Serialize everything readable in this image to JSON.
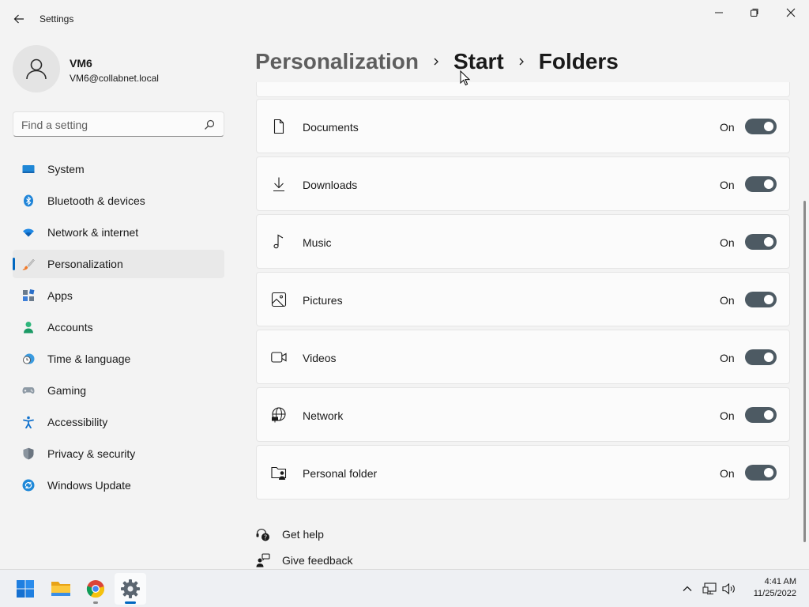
{
  "window": {
    "title": "Settings",
    "back_icon": "arrow-left-icon",
    "controls": [
      "minimize-icon",
      "maximize-icon",
      "close-icon"
    ]
  },
  "profile": {
    "name": "VM6",
    "email": "VM6@collabnet.local"
  },
  "search": {
    "placeholder": "Find a setting",
    "value": ""
  },
  "sidebar": {
    "items": [
      {
        "label": "System",
        "icon": "monitor-icon",
        "selected": false
      },
      {
        "label": "Bluetooth & devices",
        "icon": "bluetooth-icon",
        "selected": false
      },
      {
        "label": "Network & internet",
        "icon": "wifi-icon",
        "selected": false
      },
      {
        "label": "Personalization",
        "icon": "brush-icon",
        "selected": true
      },
      {
        "label": "Apps",
        "icon": "apps-icon",
        "selected": false
      },
      {
        "label": "Accounts",
        "icon": "person-icon",
        "selected": false
      },
      {
        "label": "Time & language",
        "icon": "clock-globe-icon",
        "selected": false
      },
      {
        "label": "Gaming",
        "icon": "gamepad-icon",
        "selected": false
      },
      {
        "label": "Accessibility",
        "icon": "accessibility-icon",
        "selected": false
      },
      {
        "label": "Privacy & security",
        "icon": "shield-icon",
        "selected": false
      },
      {
        "label": "Windows Update",
        "icon": "update-icon",
        "selected": false
      }
    ]
  },
  "breadcrumb": {
    "items": [
      "Personalization",
      "Start",
      "Folders"
    ],
    "separator_icon": "chevron-right-icon"
  },
  "folders": [
    {
      "label": "Documents",
      "icon": "document-icon",
      "state": "On",
      "on": true
    },
    {
      "label": "Downloads",
      "icon": "download-icon",
      "state": "On",
      "on": true
    },
    {
      "label": "Music",
      "icon": "music-note-icon",
      "state": "On",
      "on": true
    },
    {
      "label": "Pictures",
      "icon": "picture-icon",
      "state": "On",
      "on": true
    },
    {
      "label": "Videos",
      "icon": "video-camera-icon",
      "state": "On",
      "on": true
    },
    {
      "label": "Network",
      "icon": "globe-network-icon",
      "state": "On",
      "on": true
    },
    {
      "label": "Personal folder",
      "icon": "personal-folder-icon",
      "state": "On",
      "on": true
    }
  ],
  "help": {
    "get_help": "Get help",
    "give_feedback": "Give feedback"
  },
  "taskbar": {
    "apps": [
      {
        "name": "start-icon",
        "active": false
      },
      {
        "name": "file-explorer-icon",
        "active": false
      },
      {
        "name": "chrome-icon",
        "active": false
      },
      {
        "name": "settings-gear-icon",
        "active": true
      }
    ],
    "tray": [
      "chevron-up-icon",
      "network-icon",
      "volume-icon"
    ],
    "time": "4:41 AM",
    "date": "11/25/2022"
  },
  "colors": {
    "accent": "#0067c0",
    "toggle_on": "#4d5a63",
    "background": "#f3f3f3",
    "card": "#fbfbfb"
  }
}
